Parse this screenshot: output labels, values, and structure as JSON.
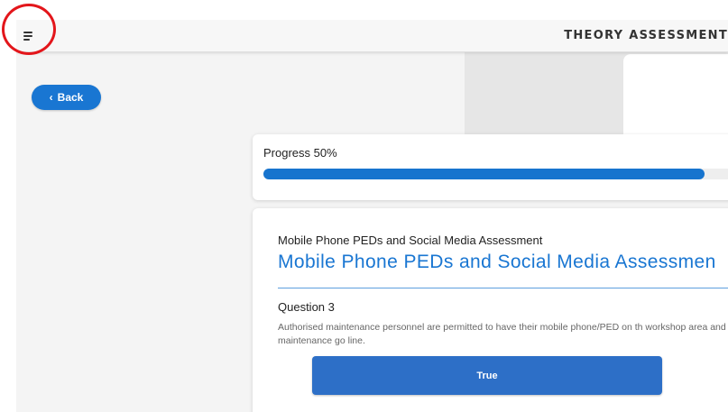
{
  "header": {
    "title": "THEORY ASSESSMENT",
    "menu_icon": "hamburger-menu-icon"
  },
  "annotation": {
    "color": "#e3161b",
    "shape": "circle"
  },
  "nav": {
    "back_label": "Back",
    "back_icon": "chevron-left-icon"
  },
  "progress": {
    "label": "Progress 50%",
    "fraction": 0.94
  },
  "assessment": {
    "subtitle": "Mobile Phone PEDs and Social Media Assessment",
    "title": "Mobile Phone PEDs and Social Media Assessmen",
    "question_number": "Question 3",
    "question_text": "Authorised maintenance personnel are permitted to have their mobile phone/PED on th workshop area and within the maintenance go line.",
    "answers": [
      {
        "label": "True"
      }
    ]
  },
  "colors": {
    "accent": "#1976d2",
    "answer_button": "#2d6fc7",
    "annotation_red": "#e3161b"
  }
}
